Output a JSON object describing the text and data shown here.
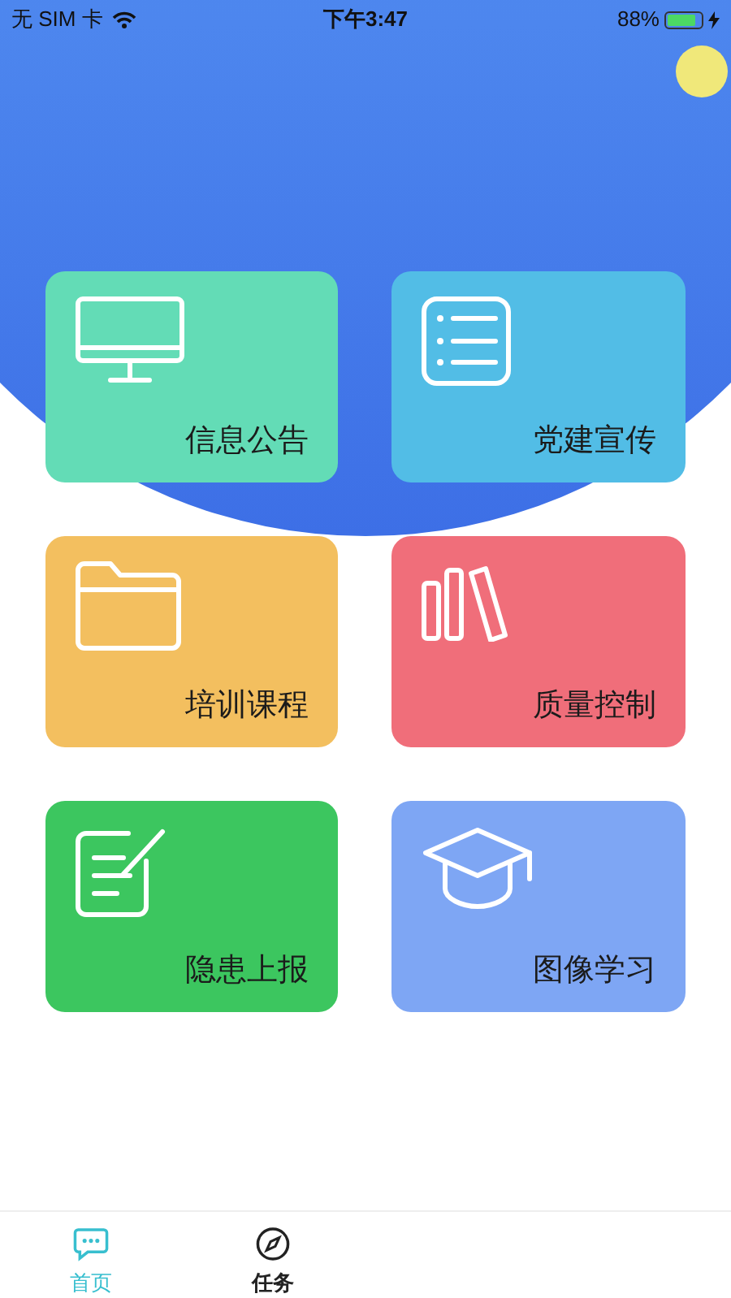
{
  "status_bar": {
    "carrier": "无 SIM 卡",
    "time": "下午3:47",
    "battery": "88%"
  },
  "cards": [
    {
      "label": "信息公告",
      "kind": "monitor",
      "color": "#63dcb6"
    },
    {
      "label": "党建宣传",
      "kind": "list",
      "color": "#52bde6"
    },
    {
      "label": "培训课程",
      "kind": "folder",
      "color": "#f3bf5f"
    },
    {
      "label": "质量控制",
      "kind": "books",
      "color": "#f06e7a"
    },
    {
      "label": "隐患上报",
      "kind": "note",
      "color": "#3cc65f"
    },
    {
      "label": "图像学习",
      "kind": "cap",
      "color": "#7ea6f4"
    }
  ],
  "tab_bar": [
    {
      "label": "首页",
      "kind": "chat",
      "selected": true
    },
    {
      "label": "任务",
      "kind": "compass",
      "selected": false
    }
  ]
}
